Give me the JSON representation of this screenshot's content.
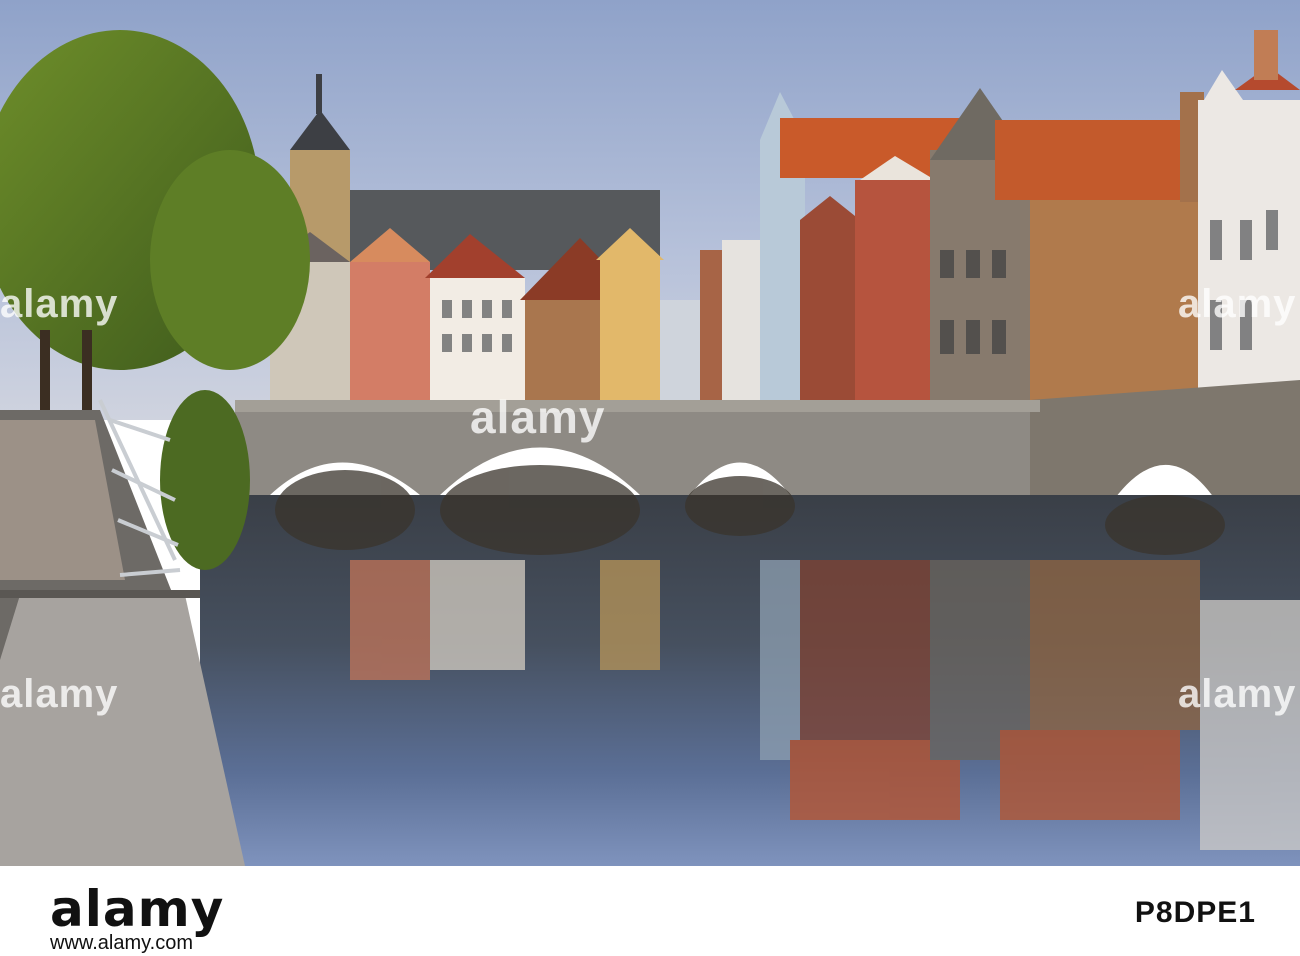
{
  "image": {
    "description_alt": "Canal with stone arch bridge and colorful gabled houses reflected in water",
    "watermark_text": "alamy",
    "watermark_side": "alamy"
  },
  "footer": {
    "brand": "alamy",
    "image_id": "P8DPE1",
    "site": "www.alamy.com"
  },
  "colors": {
    "sky": "#a9b7d6",
    "water": "#2f3f5e",
    "brick": "#9c5a3e",
    "roof": "#c85a2c",
    "stone": "#8e8a84"
  }
}
